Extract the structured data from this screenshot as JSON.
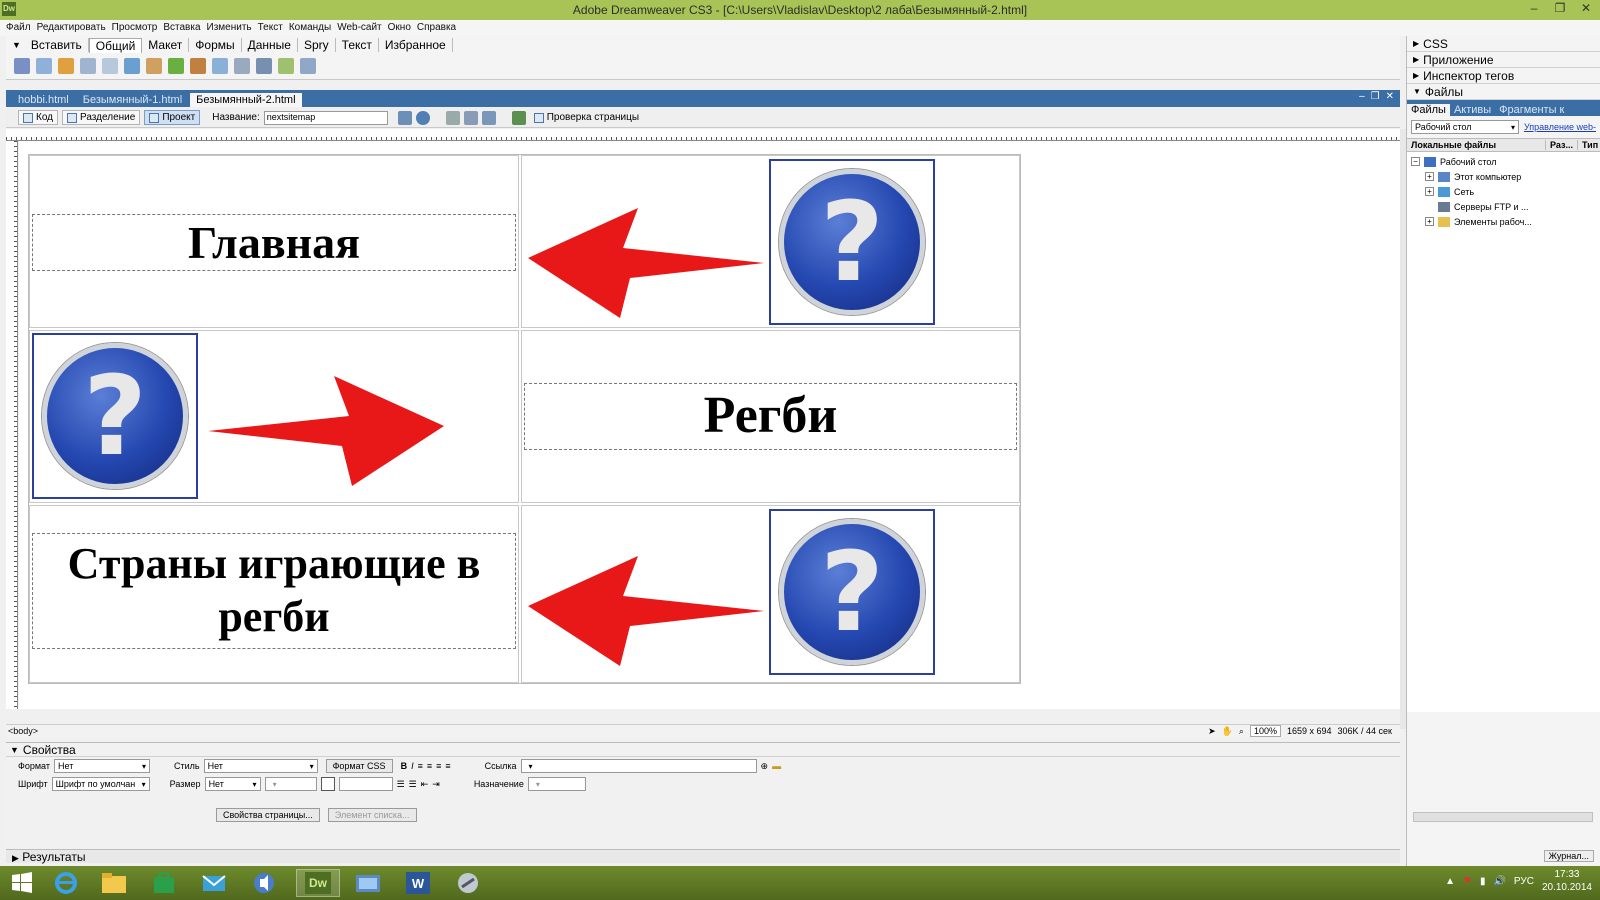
{
  "window": {
    "app_logo": "Dw",
    "title": "Adobe Dreamweaver CS3 - [C:\\Users\\Vladislav\\Desktop\\2 лаба\\Безымянный-2.html]",
    "controls": [
      "–",
      "❐",
      "✕"
    ]
  },
  "menu": [
    "Файл",
    "Редактировать",
    "Просмотр",
    "Вставка",
    "Изменить",
    "Текст",
    "Команды",
    "Web-сайт",
    "Окно",
    "Справка"
  ],
  "insert_bar": {
    "label": "Вставить",
    "tabs": [
      "Общий",
      "Макет",
      "Формы",
      "Данные",
      "Spry",
      "Текст",
      "Избранное"
    ]
  },
  "doc_tabs": [
    "hobbi.html",
    "Безымянный-1.html",
    "Безымянный-2.html"
  ],
  "doc_toolbar": {
    "code": "Код",
    "split": "Разделение",
    "design": "Проект",
    "name_label": "Название:",
    "name_value": "nextsitemap",
    "check": "Проверка страницы"
  },
  "design": {
    "heading1": "Главная",
    "heading2": "Регби",
    "heading3": "Страны играющие в регби",
    "help_glyph": "?"
  },
  "status": {
    "tag": "<body>",
    "zoom": "100%",
    "size": "1659 x 694",
    "weight": "306K / 44 сек"
  },
  "properties": {
    "title": "Свойства",
    "format_label": "Формат",
    "format_value": "Нет",
    "style_label": "Стиль",
    "style_value": "Нет",
    "css_button": "Формат CSS",
    "bold": "B",
    "italic": "I",
    "link_label": "Ссылка",
    "font_label": "Шрифт",
    "font_value": "Шрифт по умолчан",
    "size_label": "Размер",
    "size_value": "Нет",
    "target_label": "Назначение",
    "page_props": "Свойства страницы...",
    "list_item": "Элемент списка..."
  },
  "results": "Результаты",
  "panels": {
    "css": "CSS",
    "app": "Приложение",
    "tags": "Инспектор тегов",
    "files": "Файлы",
    "files_tabs": [
      "Файлы",
      "Активы",
      "Фрагменты к"
    ],
    "site": "Рабочий стол",
    "manage": "Управление web-",
    "cols": [
      "Локальные файлы",
      "Раз...",
      "Тип"
    ],
    "tree_root": "Рабочий стол",
    "tree": [
      "Этот компьютер",
      "Сеть",
      "Серверы FTP и ...",
      "Элементы рабоч..."
    ],
    "journal": "Журнал..."
  },
  "taskbar": {
    "lang": "РУС",
    "time": "17:33",
    "date": "20.10.2014",
    "dw": "Dw",
    "word": "W"
  },
  "colors": {
    "title_bar": "#a9c456",
    "doc_tabs": "#3a6ea5",
    "arrow": "#e81818",
    "help_blue": "#2447b0"
  }
}
